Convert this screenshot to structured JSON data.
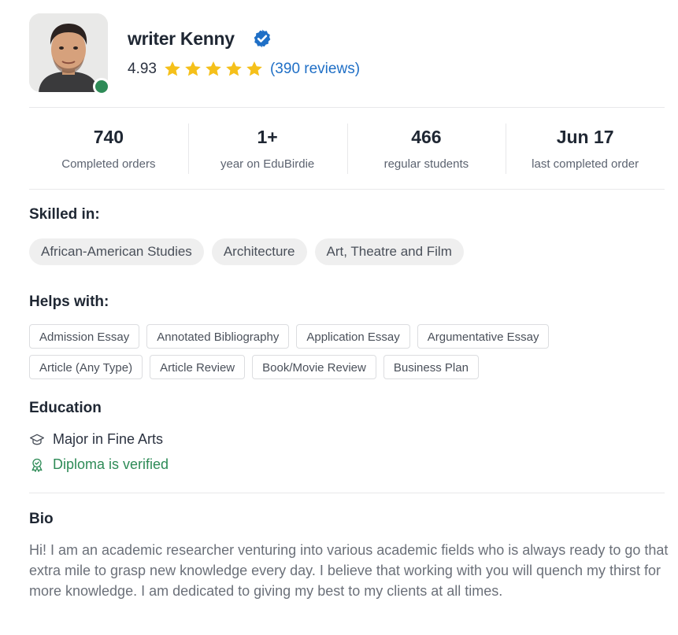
{
  "profile": {
    "name": "writer Kenny",
    "rating": "4.93",
    "star_count": 5,
    "reviews": "(390 reviews)",
    "online": true
  },
  "stats": [
    {
      "value": "740",
      "label": "Completed orders"
    },
    {
      "value": "1+",
      "label": "year on EduBirdie"
    },
    {
      "value": "466",
      "label": "regular students"
    },
    {
      "value": "Jun 17",
      "label": "last completed order"
    }
  ],
  "skilled_in": {
    "title": "Skilled in:",
    "items": [
      "African-American Studies",
      "Architecture",
      "Art, Theatre and Film"
    ]
  },
  "helps_with": {
    "title": "Helps with:",
    "items": [
      "Admission Essay",
      "Annotated Bibliography",
      "Application Essay",
      "Argumentative Essay",
      "Article (Any Type)",
      "Article Review",
      "Book/Movie Review",
      "Business Plan"
    ]
  },
  "education": {
    "title": "Education",
    "major": "Major in Fine Arts",
    "diploma": "Diploma is verified"
  },
  "bio": {
    "title": "Bio",
    "text": "Hi! I am an academic researcher venturing into various academic fields who is always ready to go that extra mile to grasp new knowledge every day. I believe that working with you will quench my thirst for more knowledge. I am dedicated to giving my best to my clients at all times."
  },
  "colors": {
    "accent_blue": "#1f6fc6",
    "verified_blue": "#1f6fc6",
    "star_gold": "#f5c01a",
    "online_green": "#2e8b57",
    "verified_green": "#2e8b57"
  },
  "icons": {
    "verified": "verified-badge-icon",
    "star": "star-icon",
    "education": "graduation-cap-icon",
    "diploma": "certificate-badge-icon"
  }
}
